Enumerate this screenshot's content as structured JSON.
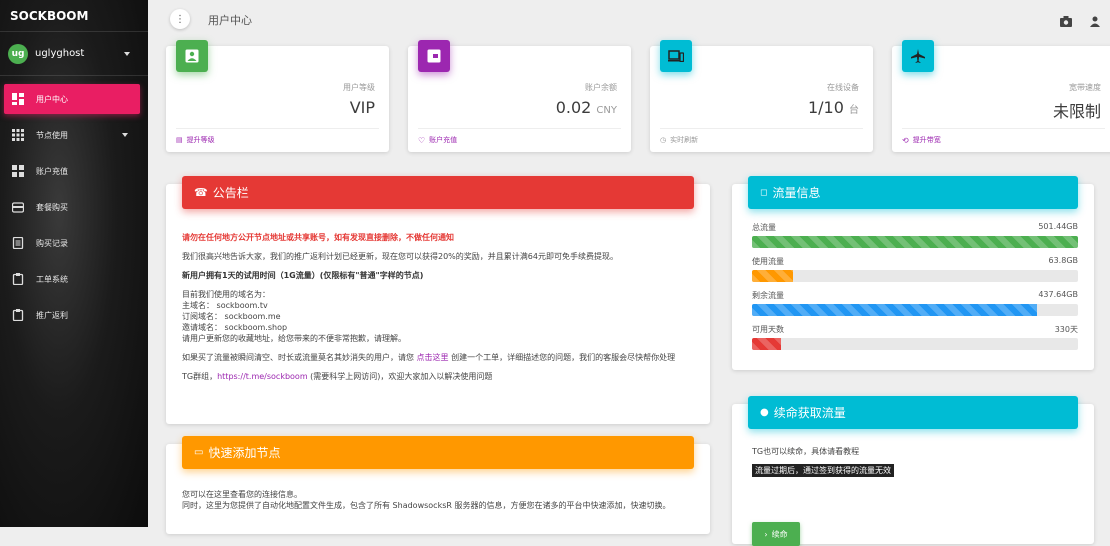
{
  "sidebar": {
    "brand": "SOCKBOOM",
    "user": {
      "avatar": "ug",
      "name": "uglyghost"
    },
    "items": [
      {
        "label": "用户中心",
        "icon": "dashboard-icon"
      },
      {
        "label": "节点使用",
        "icon": "grid-icon"
      },
      {
        "label": "账户充值",
        "icon": "wallet-icon"
      },
      {
        "label": "套餐购买",
        "icon": "shop-icon"
      },
      {
        "label": "购买记录",
        "icon": "receipt-icon"
      },
      {
        "label": "工单系统",
        "icon": "ticket-icon"
      },
      {
        "label": "推广返利",
        "icon": "share-icon"
      }
    ]
  },
  "topbar": {
    "menu_glyph": "⋮",
    "title": "用户中心"
  },
  "stats": [
    {
      "label": "用户等级",
      "value": "VIP",
      "unit": "",
      "footer": "提升等级",
      "color": "#4caf50",
      "icon": "account-box-icon"
    },
    {
      "label": "账户余额",
      "value": "0.02",
      "unit": "CNY",
      "footer": "账户充值",
      "color": "#9c27b0",
      "icon": "wallet-icon"
    },
    {
      "label": "在线设备",
      "value": "1/10",
      "unit": "台",
      "footer": "实时刷新",
      "color": "#00bcd4",
      "icon": "devices-icon"
    },
    {
      "label": "宽带速度",
      "value": "未限制",
      "unit": "",
      "footer": "提升带宽",
      "color": "#00bcd4",
      "icon": "airplane-icon"
    }
  ],
  "notice": {
    "title": "公告栏",
    "warning": "请勿在任何地方公开节点地址或共享账号，如有发现直接删除，不做任何通知",
    "p1": "我们很高兴地告诉大家，我们的推广返利计划已经更新，现在您可以获得20%的奖励，并且累计满64元即可免手续费提现。",
    "p2": "新用户拥有1天的试用时间（1G流量）(仅限标有\"普通\"字样的节点)",
    "domains_intro": "目前我们使用的域名为：",
    "main_domain": "主域名： sockboom.tv",
    "sub_domain": "订阅域名： sockboom.me",
    "invite_domain": "邀请域名： sockboom.shop",
    "domains_note": "请用户更新您的收藏地址，给您带来的不便非常抱歉，请理解。",
    "p3_before": "如果买了流量被瞬间清空、时长或流量莫名其妙消失的用户，请您",
    "p3_link": "点击这里",
    "p3_after": "创建一个工单，详细描述您的问题，我们的客服会尽快帮你处理",
    "tg_prefix": "TG群组，",
    "tg_link": "https://t.me/sockboom",
    "tg_suffix": "(需要科学上网访问)，欢迎大家加入以解决使用问题"
  },
  "traffic": {
    "title": "流量信息",
    "rows": [
      {
        "label": "总流量",
        "value": "501.44GB",
        "fraction": 1.0,
        "color": "#4caf50"
      },
      {
        "label": "使用流量",
        "value": "63.8GB",
        "fraction": 0.127,
        "color": "#ff9800"
      },
      {
        "label": "剩余流量",
        "value": "437.64GB",
        "fraction": 0.873,
        "color": "#2196f3"
      },
      {
        "label": "可用天数",
        "value": "330天",
        "fraction": 0.09,
        "color": "#e53935"
      }
    ]
  },
  "renew": {
    "title": "续命获取流量",
    "text": "TG也可以续命，具体请看教程",
    "highlight": "流量过期后，通过签到获得的流量无效",
    "button": "续命"
  },
  "quick": {
    "title": "快速添加节点",
    "p1": "您可以在这里查看您的连接信息。",
    "p2": "同时，这里为您提供了自动化地配置文件生成，包含了所有 ShadowsocksR 服务器的信息，方便您在诸多的平台中快速添加，快速切换。"
  }
}
